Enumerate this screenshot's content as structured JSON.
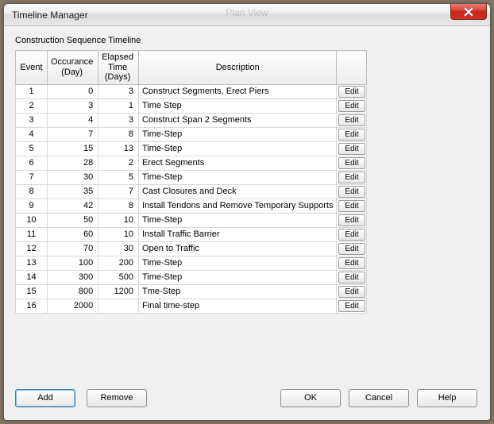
{
  "window": {
    "title": "Timeline Manager",
    "faded_text": "Plan View"
  },
  "panel": {
    "label": "Construction Sequence Timeline"
  },
  "table": {
    "headers": {
      "event": "Event",
      "occurance": "Occurance (Day)",
      "elapsed": "Elapsed Time (Days)",
      "description": "Description",
      "edit": ""
    },
    "edit_label": "Edit",
    "rows": [
      {
        "event": "1",
        "occurance": "0",
        "elapsed": "3",
        "description": "Construct Segments, Erect Piers"
      },
      {
        "event": "2",
        "occurance": "3",
        "elapsed": "1",
        "description": "Time Step"
      },
      {
        "event": "3",
        "occurance": "4",
        "elapsed": "3",
        "description": "Construct Span 2 Segments"
      },
      {
        "event": "4",
        "occurance": "7",
        "elapsed": "8",
        "description": "Time-Step"
      },
      {
        "event": "5",
        "occurance": "15",
        "elapsed": "13",
        "description": "Time-Step"
      },
      {
        "event": "6",
        "occurance": "28",
        "elapsed": "2",
        "description": "Erect Segments"
      },
      {
        "event": "7",
        "occurance": "30",
        "elapsed": "5",
        "description": "Time-Step"
      },
      {
        "event": "8",
        "occurance": "35",
        "elapsed": "7",
        "description": "Cast Closures and Deck"
      },
      {
        "event": "9",
        "occurance": "42",
        "elapsed": "8",
        "description": "Install Tendons and Remove Temporary Supports"
      },
      {
        "event": "10",
        "occurance": "50",
        "elapsed": "10",
        "description": "Time-Step"
      },
      {
        "event": "11",
        "occurance": "60",
        "elapsed": "10",
        "description": "Install Traffic Barrier"
      },
      {
        "event": "12",
        "occurance": "70",
        "elapsed": "30",
        "description": "Open to Traffic"
      },
      {
        "event": "13",
        "occurance": "100",
        "elapsed": "200",
        "description": "Time-Step"
      },
      {
        "event": "14",
        "occurance": "300",
        "elapsed": "500",
        "description": "Time-Step"
      },
      {
        "event": "15",
        "occurance": "800",
        "elapsed": "1200",
        "description": "Tme-Step"
      },
      {
        "event": "16",
        "occurance": "2000",
        "elapsed": "",
        "description": "Final time-step"
      }
    ]
  },
  "buttons": {
    "add": "Add",
    "remove": "Remove",
    "ok": "OK",
    "cancel": "Cancel",
    "help": "Help"
  }
}
